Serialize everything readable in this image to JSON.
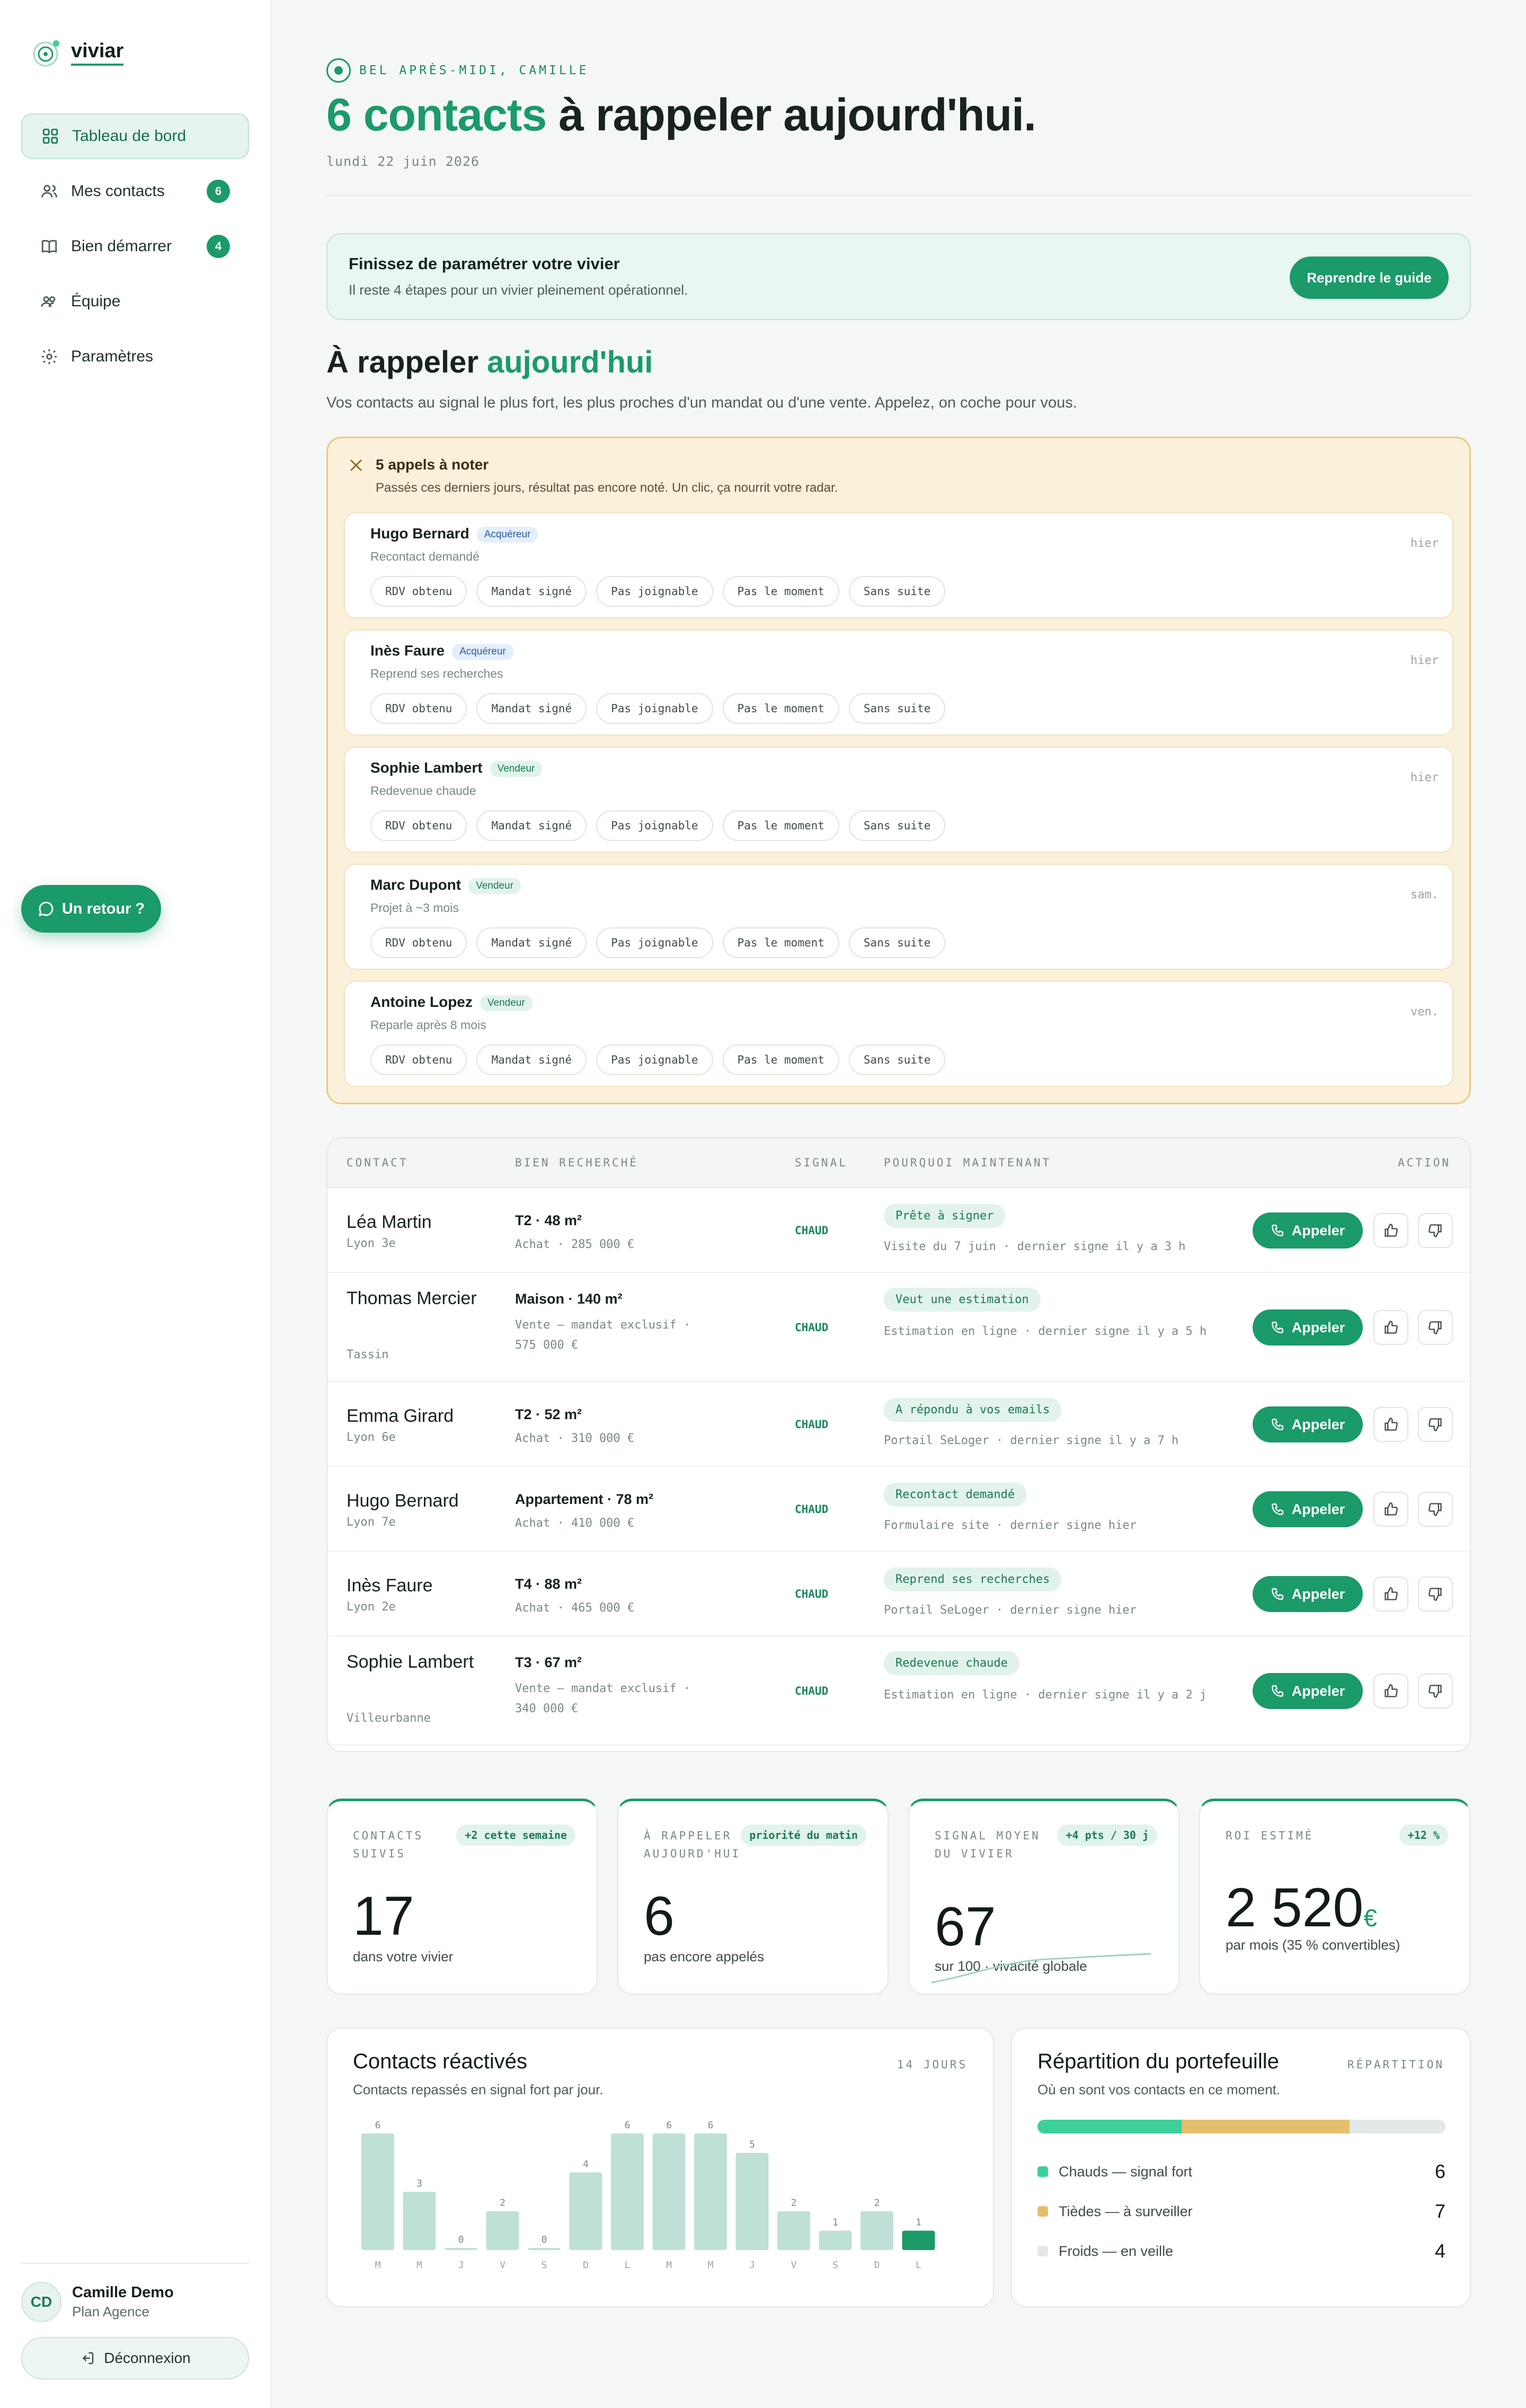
{
  "app": {
    "name": "viviar"
  },
  "colors": {
    "accent": "#1b9a6a",
    "warm": "#e3be6c",
    "cold": "#e3e9e6",
    "pending_bg": "#fbf0da"
  },
  "sidebar": {
    "items": [
      {
        "label": "Tableau de bord",
        "icon": "grid-icon",
        "active": true
      },
      {
        "label": "Mes contacts",
        "icon": "users-icon",
        "badge": "6"
      },
      {
        "label": "Bien démarrer",
        "icon": "book-icon",
        "badge": "4"
      },
      {
        "label": "Équipe",
        "icon": "team-icon"
      },
      {
        "label": "Paramètres",
        "icon": "gear-icon"
      }
    ],
    "feedback_label": "Un retour ?",
    "user": {
      "initials": "CD",
      "name": "Camille Demo",
      "plan": "Plan Agence"
    },
    "logout_label": "Déconnexion"
  },
  "header": {
    "greeting": "BEL APRÈS-MIDI, CAMILLE",
    "headline_accent": "6 contacts",
    "headline_rest": " à rappeler aujourd'hui.",
    "date": "lundi 22 juin 2026"
  },
  "guide": {
    "title": "Finissez de paramétrer votre vivier",
    "subtitle": "Il reste 4 étapes pour un vivier pleinement opérationnel.",
    "button": "Reprendre le guide"
  },
  "section": {
    "title_main": "À rappeler ",
    "title_accent": "aujourd'hui",
    "subtitle": "Vos contacts au signal le plus fort, les plus proches d'un mandat ou d'une vente. Appelez, on coche pour vous."
  },
  "pending": {
    "title": "5 appels à noter",
    "subtitle": "Passés ces derniers jours, résultat pas encore noté. Un clic, ça nourrit votre radar.",
    "outcomes": [
      "RDV obtenu",
      "Mandat signé",
      "Pas joignable",
      "Pas le moment",
      "Sans suite"
    ],
    "cards": [
      {
        "name": "Hugo Bernard",
        "tag": "Acquéreur",
        "tag_type": "acq",
        "note": "Recontact demandé",
        "when": "hier"
      },
      {
        "name": "Inès Faure",
        "tag": "Acquéreur",
        "tag_type": "acq",
        "note": "Reprend ses recherches",
        "when": "hier"
      },
      {
        "name": "Sophie Lambert",
        "tag": "Vendeur",
        "tag_type": "vend",
        "note": "Redevenue chaude",
        "when": "hier"
      },
      {
        "name": "Marc Dupont",
        "tag": "Vendeur",
        "tag_type": "vend",
        "note": "Projet à ~3 mois",
        "when": "sam."
      },
      {
        "name": "Antoine Lopez",
        "tag": "Vendeur",
        "tag_type": "vend",
        "note": "Reparle après 8 mois",
        "when": "ven."
      }
    ]
  },
  "table": {
    "headers": {
      "contact": "CONTACT",
      "property": "BIEN RECHERCHÉ",
      "signal": "SIGNAL",
      "why": "POURQUOI MAINTENANT",
      "action": "ACTION"
    },
    "call_label": "Appeler",
    "rows": [
      {
        "name": "Léa Martin",
        "city": "Lyon 3e",
        "property": "T2 · 48 m²",
        "price": "Achat · 285 000 €",
        "signal": "CHAUD",
        "reason": "Prête à signer",
        "source": "Visite du 7 juin · dernier signe il y a 3 h"
      },
      {
        "name": "Thomas Mercier",
        "city": "Tassin",
        "property": "Maison · 140 m²",
        "price": "Vente — mandat exclusif · 575 000 €",
        "signal": "CHAUD",
        "reason": "Veut une estimation",
        "source": "Estimation en ligne · dernier signe il y a 5 h"
      },
      {
        "name": "Emma Girard",
        "city": "Lyon 6e",
        "property": "T2 · 52 m²",
        "price": "Achat · 310 000 €",
        "signal": "CHAUD",
        "reason": "A répondu à vos emails",
        "source": "Portail SeLoger · dernier signe il y a 7 h"
      },
      {
        "name": "Hugo Bernard",
        "city": "Lyon 7e",
        "property": "Appartement · 78 m²",
        "price": "Achat · 410 000 €",
        "signal": "CHAUD",
        "reason": "Recontact demandé",
        "source": "Formulaire site · dernier signe hier"
      },
      {
        "name": "Inès Faure",
        "city": "Lyon 2e",
        "property": "T4 · 88 m²",
        "price": "Achat · 465 000 €",
        "signal": "CHAUD",
        "reason": "Reprend ses recherches",
        "source": "Portail SeLoger · dernier signe hier"
      },
      {
        "name": "Sophie Lambert",
        "city": "Villeurbanne",
        "property": "T3 · 67 m²",
        "price": "Vente — mandat exclusif · 340 000 €",
        "signal": "CHAUD",
        "reason": "Redevenue chaude",
        "source": "Estimation en ligne · dernier signe il y a 2 j"
      }
    ]
  },
  "stats": [
    {
      "label": "CONTACTS SUIVIS",
      "chip": "+2 cette semaine",
      "value": "17",
      "foot": "dans votre vivier"
    },
    {
      "label": "À RAPPELER AUJOURD'HUI",
      "chip": "priorité du matin",
      "value": "6",
      "foot": "pas encore appelés"
    },
    {
      "label": "SIGNAL MOYEN DU VIVIER",
      "chip": "+4 pts / 30 j",
      "value": "67",
      "foot": "sur 100 · vivacité globale"
    },
    {
      "label": "ROI ESTIMÉ",
      "chip": "+12 %",
      "value": "2 520",
      "unit": "€",
      "foot": "par mois (35 % convertibles)"
    }
  ],
  "reactivated": {
    "title": "Contacts réactivés",
    "subtitle": "Contacts repassés en signal fort par jour.",
    "period": "14 JOURS"
  },
  "chart_data": {
    "type": "bar",
    "title": "Contacts réactivés",
    "categories": [
      "M",
      "M",
      "J",
      "V",
      "S",
      "D",
      "L",
      "M",
      "M",
      "J",
      "V",
      "S",
      "D",
      "L"
    ],
    "values": [
      6,
      3,
      0,
      2,
      0,
      4,
      6,
      6,
      6,
      5,
      2,
      1,
      2,
      1
    ],
    "highlight_index": 13,
    "ylim": [
      0,
      6
    ],
    "grid": false,
    "legend": "none"
  },
  "repartition": {
    "title": "Répartition du portefeuille",
    "subtitle": "Où en sont vos contacts en ce moment.",
    "tag": "RÉPARTITION",
    "segments": [
      {
        "label": "Chauds — signal fort",
        "count": 6,
        "color": "#3ccf9a"
      },
      {
        "label": "Tièdes — à surveiller",
        "count": 7,
        "color": "#e3be6c"
      },
      {
        "label": "Froids — en veille",
        "count": 4,
        "color": "#e3e9e6"
      }
    ]
  }
}
